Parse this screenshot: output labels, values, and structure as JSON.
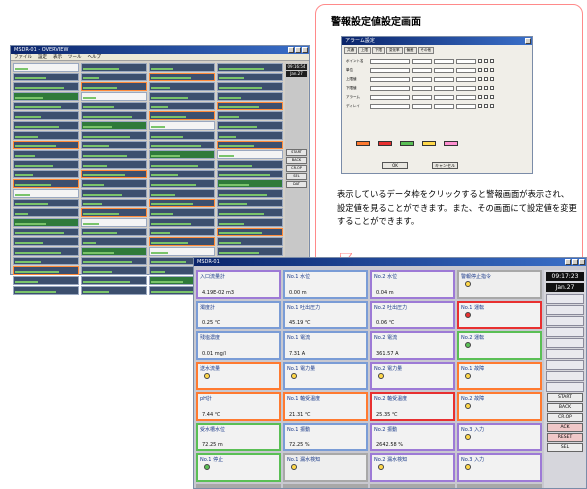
{
  "callout": {
    "title": "警報設定値設定画面",
    "description": "表示しているデータ枠をクリックすると警報画面が表示され、設定値を見ることができます。また、その画面にて設定値を変更することができます。"
  },
  "left_window": {
    "title": "MSDR-01 - OVERVIEW",
    "menu": [
      "ファイル",
      "設定",
      "表示",
      "ツール",
      "ヘルプ"
    ],
    "clock": "09:16:54",
    "date": "Jan.27",
    "side_buttons": [
      "START",
      "BACK",
      "CR.OP",
      "SEL",
      "DAT"
    ]
  },
  "dialog": {
    "title": "アラーム設定",
    "tabs": [
      "共通",
      "上限",
      "下限",
      "変化率",
      "偏差",
      "その他"
    ],
    "row_labels": [
      "ポイント名",
      "単位",
      "上限値",
      "下限値",
      "アラーム",
      "ディレイ"
    ],
    "ok": "OK",
    "cancel": "キャンセル"
  },
  "main_window": {
    "title": "MSDR-01",
    "clock": "09:17:23",
    "date": "Jan.27",
    "side_buttons": [
      "START",
      "BACK",
      "CR.OP",
      "ACK",
      "RESET",
      "SEL"
    ],
    "panels": [
      {
        "label": "入口流量計",
        "value": "4.19E-02 m3",
        "color": "purple"
      },
      {
        "label": "No.1 水位",
        "value": "0.00 m",
        "color": "blue"
      },
      {
        "label": "No.2 水位",
        "value": "0.04 m",
        "color": "purple"
      },
      {
        "label": "警報停止指令",
        "value": "",
        "color": "grey"
      },
      {
        "label": "濁度計",
        "value": "0.25 ℃",
        "color": "blue"
      },
      {
        "label": "No.1 吐出圧力",
        "value": "45.19 ℃",
        "color": "blue"
      },
      {
        "label": "No.2 吐出圧力",
        "value": "0.06 ℃",
        "color": "purple"
      },
      {
        "label": "No.1 運転",
        "value": "",
        "color": "red"
      },
      {
        "label": "残塩濃度",
        "value": "0.01 mg/l",
        "color": "blue"
      },
      {
        "label": "No.1 電流",
        "value": "7.31 A",
        "color": "blue"
      },
      {
        "label": "No.2 電流",
        "value": "361.57 A",
        "color": "purple"
      },
      {
        "label": "No.2 運転",
        "value": "",
        "color": "green"
      },
      {
        "label": "送水流量",
        "value": "",
        "color": "orange"
      },
      {
        "label": "No.1 電力量",
        "value": "",
        "color": "blue"
      },
      {
        "label": "No.2 電力量",
        "value": "",
        "color": "purple"
      },
      {
        "label": "No.1 故障",
        "value": "",
        "color": "orange"
      },
      {
        "label": "pH計",
        "value": "7.44 ℃",
        "color": "orange"
      },
      {
        "label": "No.1 軸受温度",
        "value": "21.31 ℃",
        "color": "orange"
      },
      {
        "label": "No.2 軸受温度",
        "value": "25.35 ℃",
        "color": "red"
      },
      {
        "label": "No.2 故障",
        "value": "",
        "color": "orange"
      },
      {
        "label": "受水槽水位",
        "value": "72.25 m",
        "color": "green"
      },
      {
        "label": "No.1 振動",
        "value": "72.25 %",
        "color": "blue"
      },
      {
        "label": "No.2 振動",
        "value": "2642.58 %",
        "color": "purple"
      },
      {
        "label": "No.3 入力",
        "value": "",
        "color": "purple"
      },
      {
        "label": "No.1 停止",
        "value": "",
        "color": "green"
      },
      {
        "label": "No.1 漏水検知",
        "value": "",
        "color": "grey"
      },
      {
        "label": "No.2 漏水検知",
        "value": "",
        "color": "purple"
      },
      {
        "label": "No.3 入力",
        "value": "",
        "color": "purple"
      },
      {
        "label": "非常用ダンパー",
        "value": "",
        "color": "grey"
      },
      {
        "label": "No.1 塩素検知",
        "value": "",
        "color": "grey"
      },
      {
        "label": "No.2 塩素検知",
        "value": "",
        "color": "grey"
      },
      {
        "label": "No.3 入力",
        "value": "",
        "color": "grey"
      }
    ]
  }
}
